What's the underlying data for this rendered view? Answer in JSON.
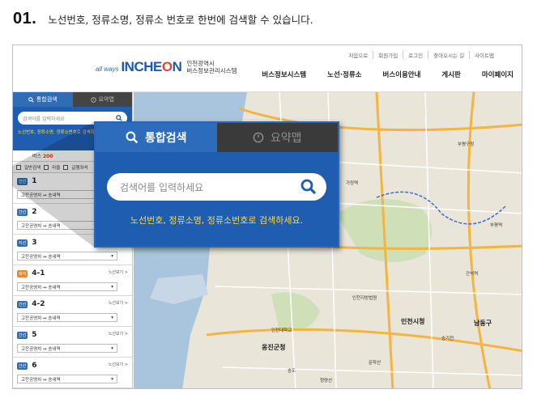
{
  "step": {
    "number": "01.",
    "text": "노선번호, 정류소명, 정류소 번호로 한번에 검색할 수 있습니다."
  },
  "site": {
    "logo_prefix": "all ways",
    "logo_main_a": "INCHE",
    "logo_main_b": "O",
    "logo_main_c": "N",
    "logo_sub1": "인천광역시",
    "logo_sub2": "버스정보관리시스템",
    "util_links": [
      "처음으로",
      "회원가입",
      "로그인",
      "찾아오시는 길",
      "사이트맵"
    ],
    "nav": [
      "버스정보시스템",
      "노선·정류소",
      "버스이용안내",
      "게시판",
      "마이페이지"
    ]
  },
  "sidebar": {
    "tab_search": "통합검색",
    "tab_summary": "요약맵",
    "placeholder": "검색어를 입력하세요",
    "hint": "노선번호, 정류소명, 정류소번호로 검색하세요.",
    "count_label": "버스",
    "count_value": "200",
    "filters": [
      "일반검색",
      "마을",
      "급행좌석"
    ],
    "routes": [
      {
        "badge": "간선",
        "color": "#2f6db5",
        "number": "1",
        "more": "노선보기 >",
        "dir": "고잔공영차 ↔ 송내역"
      },
      {
        "badge": "간선",
        "color": "#2f6db5",
        "number": "2",
        "more": "노선보기 >",
        "dir": "고잔공영차 ↔ 송내역"
      },
      {
        "badge": "지선",
        "color": "#2f6db5",
        "number": "3",
        "more": "노선보기 >",
        "dir": "고잔공영차 ↔ 송내역"
      },
      {
        "badge": "좌석",
        "color": "#e8882a",
        "number": "4-1",
        "more": "노선보기 >",
        "dir": "고잔공영차 ↔ 송내역"
      },
      {
        "badge": "간선",
        "color": "#2f6db5",
        "number": "4-2",
        "more": "노선보기 >",
        "dir": "고잔공영차 ↔ 송내역"
      },
      {
        "badge": "간선",
        "color": "#2f6db5",
        "number": "5",
        "more": "노선보기 >",
        "dir": "고잔공영차 ↔ 송내역"
      },
      {
        "badge": "간선",
        "color": "#2f6db5",
        "number": "6",
        "more": "노선보기 >",
        "dir": "고잔공영차 ↔ 송내역"
      }
    ]
  },
  "popup": {
    "tab_search": "통합검색",
    "tab_summary": "요약맵",
    "placeholder": "검색어를 입력하세요",
    "hint": "노선번호, 정류소명, 정류소번호로 검색하세요."
  },
  "map_labels": {
    "city_hall": "인천시청",
    "district": "옹진군청",
    "namdong": "남동구",
    "misc": [
      "가정역",
      "인천지방법원",
      "부평역",
      "간석역",
      "인천대학교",
      "문학산",
      "승기천",
      "송도",
      "부평구청",
      "청량산"
    ]
  },
  "colors": {
    "accent": "#1f5db0",
    "hint": "#ffd93d",
    "badge_orange": "#e8882a"
  }
}
